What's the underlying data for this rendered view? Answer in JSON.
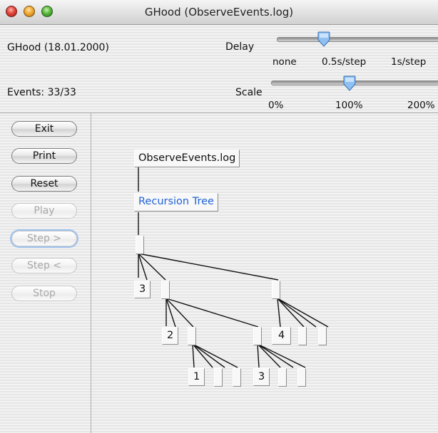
{
  "window": {
    "title": "GHood (ObserveEvents.log)"
  },
  "header": {
    "version": "GHood (18.01.2000)",
    "events": "Events: 33/33",
    "delay": {
      "label": "Delay",
      "ticks": [
        "none",
        "0.5s/step",
        "1s/step"
      ],
      "value": "0.5s/step"
    },
    "scale": {
      "label": "Scale",
      "ticks": [
        "0%",
        "100%",
        "200%"
      ],
      "value": "100%"
    }
  },
  "buttons": {
    "exit": "Exit",
    "print": "Print",
    "reset": "Reset",
    "play": "Play",
    "step_forward": "Step >",
    "step_back": "Step <",
    "stop": "Stop"
  },
  "tree": {
    "log_node": "ObserveEvents.log",
    "title_node": "Recursion Tree",
    "title_color": "#1f62d6",
    "values": [
      "3",
      "2",
      "4",
      "1",
      "3"
    ]
  }
}
